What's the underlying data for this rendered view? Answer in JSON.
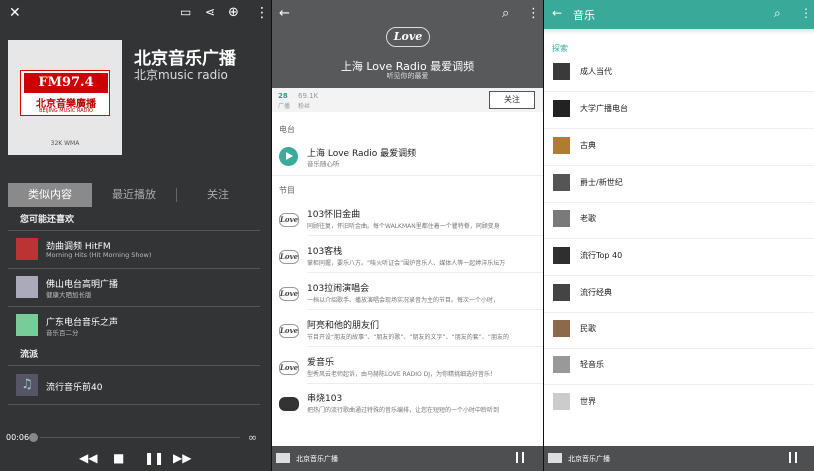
{
  "p1": {
    "title": "北京音乐广播",
    "subtitle": "北京music radio",
    "cover": {
      "fm": "FM97.4",
      "cn": "北京音樂廣播",
      "en": "BEIJING MUSIC RADIO",
      "sub": "32K WMA"
    },
    "tabs": [
      "类似内容",
      "最近播放",
      "关注"
    ],
    "section1": "您可能还喜欢",
    "items": [
      {
        "title": "劲曲调频 HitFM",
        "desc": "Morning Hits (Hit Morning Show)"
      },
      {
        "title": "佛山电台高明广播",
        "desc": "健康大晒加长版"
      },
      {
        "title": "广东电台音乐之声",
        "desc": "音乐百二分"
      }
    ],
    "section2": "流派",
    "genre": "流行音乐前40",
    "time": "00:06"
  },
  "p2": {
    "logo": "Love",
    "title": "上海 Love Radio 最爱调频",
    "subtitle": "听见你的最爱",
    "stat1_num": "28",
    "stat1_label": "广播",
    "stat2_num": "69.1K",
    "stat2_label": "粉丝",
    "follow": "关注",
    "station_section": "电台",
    "station_name": "上海 Love Radio 最爱调频",
    "station_desc": "音乐随心听",
    "program_section": "节目",
    "programs": [
      {
        "title": "103怀旧金曲",
        "desc": "同顾往复，怀旧听金曲。每个WALKMAN里都住着一个瞿特脊，同顾变身"
      },
      {
        "title": "103客栈",
        "desc": "掌柜同握，要乐八方。“唉火听证会”围炉音乐人、媒体人等一起婷洋乐坛万"
      },
      {
        "title": "103拉闹演唱会",
        "desc": "一档以介绍歌手、播放演唱会现场实况录音为主的节目。每次一个小时，"
      },
      {
        "title": "阿亮和他的朋友们",
        "desc": "节目开设“朋友的故事”、“朋友的歌”、“朋友的文字”、“朋友的套”、“朋友的"
      },
      {
        "title": "爱音乐",
        "desc": "型秀风云老师起诉，由马赫陈LOVE RADIO DJ，为你精挑细选好音乐！"
      },
      {
        "title": "串烧103",
        "desc": "把热门的流行歌曲通过特殊的音乐编排，让您在短短的一个小时中聆听到"
      }
    ],
    "mini": "北京音乐广播"
  },
  "p3": {
    "title": "音乐",
    "section": "探索",
    "items": [
      "成人当代",
      "大学广播电台",
      "古典",
      "爵士/新世纪",
      "老歌",
      "流行Top 40",
      "流行经典",
      "民歌",
      "轻音乐",
      "世界"
    ],
    "mini": "北京音乐广播"
  }
}
